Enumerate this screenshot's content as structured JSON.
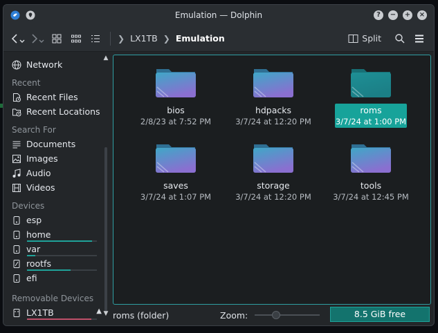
{
  "window": {
    "title": "Emulation — Dolphin"
  },
  "toolbar": {
    "breadcrumbs": [
      "LX1TB",
      "Emulation"
    ],
    "split_label": "Split"
  },
  "sidebar": {
    "network": "Network",
    "recent_header": "Recent",
    "recent": [
      "Recent Files",
      "Recent Locations"
    ],
    "search_header": "Search For",
    "search": [
      "Documents",
      "Images",
      "Audio",
      "Videos"
    ],
    "devices_header": "Devices",
    "devices": [
      {
        "label": "esp",
        "usage": 0
      },
      {
        "label": "home",
        "usage": 0.93
      },
      {
        "label": "var",
        "usage": 0.12
      },
      {
        "label": "rootfs",
        "usage": 0.62
      },
      {
        "label": "efi",
        "usage": 0
      }
    ],
    "removable_header": "Removable Devices",
    "removable": [
      {
        "label": "LX1TB",
        "usage": 0.92
      }
    ]
  },
  "files": [
    {
      "name": "bios",
      "date": "2/8/23 at 7:52 PM",
      "selected": false
    },
    {
      "name": "hdpacks",
      "date": "3/7/24 at 12:20 PM",
      "selected": false
    },
    {
      "name": "roms",
      "date": "3/7/24 at 1:00 PM",
      "selected": true
    },
    {
      "name": "saves",
      "date": "3/7/24 at 1:07 PM",
      "selected": false
    },
    {
      "name": "storage",
      "date": "3/7/24 at 12:20 PM",
      "selected": false
    },
    {
      "name": "tools",
      "date": "3/7/24 at 12:45 PM",
      "selected": false
    }
  ],
  "statusbar": {
    "text": "roms (folder)",
    "zoom_label": "Zoom:",
    "zoom_level": 0.3,
    "free_space": "8.5 GiB free"
  },
  "colors": {
    "accent": "#1fa39a",
    "folder_top": "#3fa7c7",
    "folder_bottom": "#8a6fd0"
  }
}
